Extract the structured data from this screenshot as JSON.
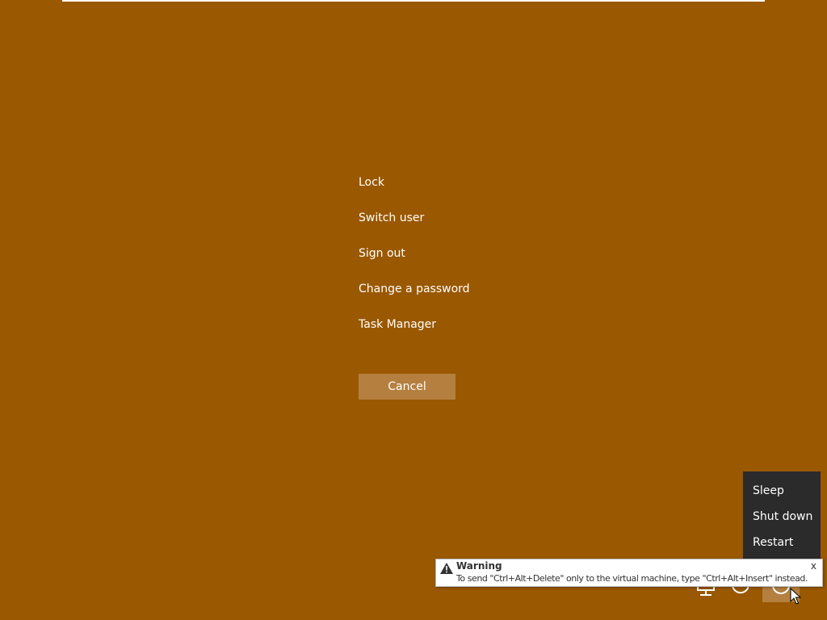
{
  "options_menu": {
    "items": [
      {
        "label": "Lock"
      },
      {
        "label": "Switch user"
      },
      {
        "label": "Sign out"
      },
      {
        "label": "Change a password"
      },
      {
        "label": "Task Manager"
      }
    ]
  },
  "cancel": {
    "label": "Cancel"
  },
  "power_menu": {
    "items": [
      {
        "label": "Sleep"
      },
      {
        "label": "Shut down"
      },
      {
        "label": "Restart"
      }
    ]
  },
  "tray": {
    "icons": [
      "network-icon",
      "ease-of-access-icon",
      "power-icon"
    ]
  },
  "warning": {
    "title": "Warning",
    "message": "To send \"Ctrl+Alt+Delete\" only to the virtual machine, type \"Ctrl+Alt+Insert\" instead.",
    "close_label": "x"
  },
  "colors": {
    "background": "#9a5800",
    "button": "#b57f3f",
    "power_menu_bg": "#2b2b2b",
    "text": "#ffffff"
  }
}
